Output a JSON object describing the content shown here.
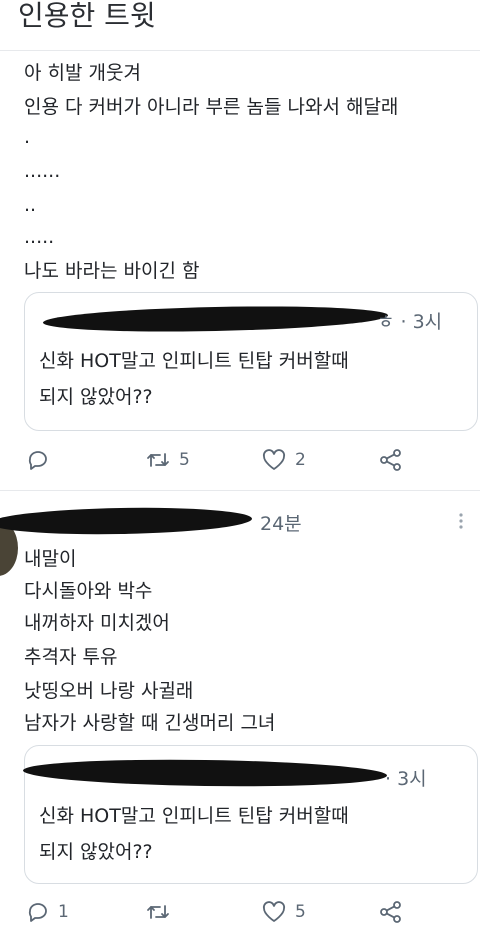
{
  "header": {
    "title": "인용한 트윗"
  },
  "tweet1": {
    "lines": [
      "아 히발 개웃겨",
      "인용 다 커버가 아니라 부른 놈들 나와서 해달래",
      ".",
      "......",
      "..",
      ".....",
      "나도 바라는 바이긴 함"
    ],
    "quote": {
      "time": "ㅎ · 3시",
      "text_line1": "신화 HOT말고 인피니트 틴탑 커버할때",
      "text_line2": "되지 않았어??"
    },
    "actions": {
      "replies": "",
      "retweets": "5",
      "likes": "2"
    }
  },
  "tweet2": {
    "time": "24분",
    "lines": [
      "내말이",
      "다시돌아와 박수",
      "내꺼하자 미치겠어",
      "추격자 투유",
      "낫띵오버  나랑 사귈래",
      "남자가 사랑할 때  긴생머리 그녀"
    ],
    "quote": {
      "time": "· 3시",
      "text_line1": "신화 HOT말고 인피니트 틴탑 커버할때",
      "text_line2": "되지 않았어??"
    },
    "actions": {
      "replies": "1",
      "retweets": "",
      "likes": "5"
    }
  },
  "colors": {
    "text": "#22252a",
    "muted": "#5b6774",
    "border": "#d8dde2",
    "redaction": "#111111"
  }
}
